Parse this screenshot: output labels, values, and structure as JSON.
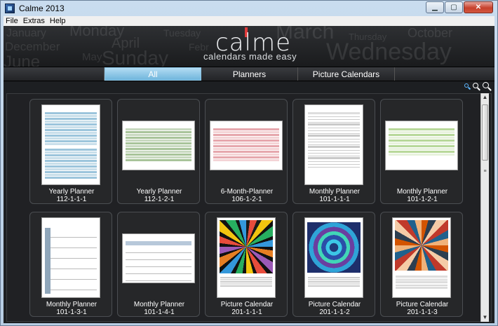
{
  "window": {
    "title": "Calme 2013"
  },
  "menu": [
    "File",
    "Extras",
    "Help"
  ],
  "banner": {
    "logo": "calme",
    "tagline": "calendars made easy",
    "background_words": [
      "January",
      "Monday",
      "Tuesday",
      "March",
      "October",
      "December",
      "April",
      "Febr",
      "Thursday",
      "Wednesday",
      "June",
      "May",
      "Sunday"
    ]
  },
  "tabs": [
    {
      "label": "All",
      "active": true
    },
    {
      "label": "Planners",
      "active": false
    },
    {
      "label": "Picture Calendars",
      "active": false
    }
  ],
  "zoom_icons": [
    "zoom-small-icon",
    "zoom-medium-icon",
    "zoom-large-icon"
  ],
  "cards": [
    {
      "title": "Yearly Planner",
      "code": "112-1-1-1",
      "kind": "yearly-blue"
    },
    {
      "title": "Yearly Planner",
      "code": "112-1-2-1",
      "kind": "yearly-green"
    },
    {
      "title": "6-Month-Planner",
      "code": "106-1-2-1",
      "kind": "sixmonth-red"
    },
    {
      "title": "Monthly Planner",
      "code": "101-1-1-1",
      "kind": "monthly-list"
    },
    {
      "title": "Monthly Planner",
      "code": "101-1-2-1",
      "kind": "monthly-green"
    },
    {
      "title": "Monthly Planner",
      "code": "101-1-3-1",
      "kind": "monthly-grid"
    },
    {
      "title": "Monthly Planner",
      "code": "101-1-4-1",
      "kind": "monthly-land"
    },
    {
      "title": "Picture Calendar",
      "code": "201-1-1-1",
      "kind": "picture-star"
    },
    {
      "title": "Picture Calendar",
      "code": "201-1-1-2",
      "kind": "picture-kaleido"
    },
    {
      "title": "Picture Calendar",
      "code": "201-1-1-3",
      "kind": "picture-mandala"
    }
  ],
  "colors": {
    "tab_active": "#7dbfe3",
    "background": "#1d1f22",
    "logo_accent": "#e03a3a"
  }
}
